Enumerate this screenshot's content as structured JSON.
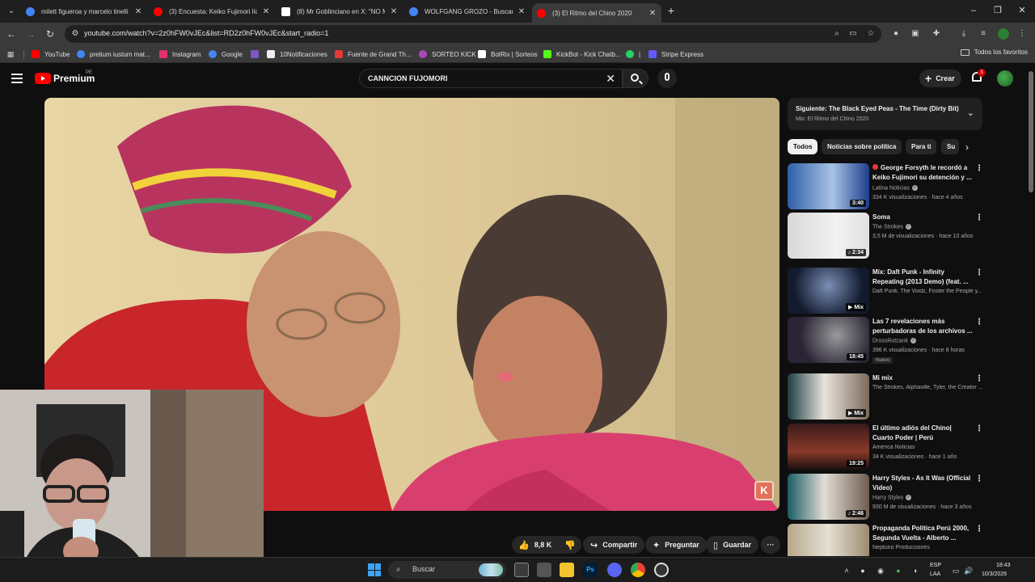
{
  "browser": {
    "tabs": [
      {
        "title": "milett figueroa y marcelo tinelli",
        "favicon_color": "#4285f4",
        "close": "✕"
      },
      {
        "title": "(3) Encuesta: Keiko Fujimori líder",
        "favicon_color": "#ff0000",
        "close": "✕"
      },
      {
        "title": "(8) Mr Goblinciano en X: \"NO M",
        "favicon_color": "#ffffff",
        "close": "✕"
      },
      {
        "title": "WOLFGANG GROZO - Buscar co",
        "favicon_color": "#4285f4",
        "close": "✕"
      },
      {
        "title": "(3) El Ritmo del Chino 2020",
        "favicon_color": "#ff0000",
        "close": "✕",
        "active": true
      }
    ],
    "url": "youtube.com/watch?v=2z0hFW0vJEc&list=RD2z0hFW0vJEc&start_radio=1",
    "bookmarks": [
      {
        "label": "YouTube",
        "color": "#ff0000"
      },
      {
        "label": "pretium iustum mat...",
        "color": "#4285f4"
      },
      {
        "label": "Instagram",
        "color": "#e1306c"
      },
      {
        "label": "Google",
        "color": "#4285f4"
      },
      {
        "label": "",
        "color": "#7e57c2"
      },
      {
        "label": "10Notificaciones",
        "color": "#ffffff"
      },
      {
        "label": "Fuente de Grand Th...",
        "color": "#e53935"
      },
      {
        "label": "SORTEO KICK",
        "color": "#ab47bc"
      },
      {
        "label": "BotRix | Sorteos",
        "color": "#ffffff"
      },
      {
        "label": "KickBot - Kick Chatb...",
        "color": "#53fc18"
      },
      {
        "label": "|",
        "color": "#25d366"
      },
      {
        "label": "Stripe Express",
        "color": "#635bff"
      }
    ],
    "all_bookmarks": "Todos los favoritos"
  },
  "youtube": {
    "logo_text": "Premium",
    "country": "PE",
    "search_query": "CANNCION FUJOMORI",
    "create_label": "Crear",
    "notifications": "3",
    "actions": {
      "likes": "8,8 K",
      "share": "Compartir",
      "ask": "Preguntar",
      "save": "Guardar",
      "more": "···"
    },
    "up_next": {
      "title": "Siguiente: The Black Eyed Peas - The Time (Dirty Bit)",
      "subtitle": "Mix: El Ritmo del Chino 2020"
    },
    "chips": [
      "Todos",
      "Noticias sobre política",
      "Para ti",
      "Su"
    ],
    "recommendations": [
      {
        "title": "George Forsyth le recordó a Keiko Fujimori su detención y ...",
        "channel": "Latina Noticias",
        "meta": "334 K visualizaciones · hace 4 años",
        "duration": "3:40",
        "live": true,
        "verified": true
      },
      {
        "title": "Soma",
        "channel": "The Strokes",
        "meta": "3,5 M de visualizaciones · hace 10 años",
        "duration": "♪ 2:34",
        "verified": true
      },
      {
        "title": "Mix: Daft Punk - Infinity Repeating (2013 Demo) (feat. ...",
        "channel": "Daft Punk, The Voidz, Foster the People y...",
        "meta": "",
        "duration": "▶ Mix"
      },
      {
        "title": "Las 7 revelaciones más perturbadoras de los archivos ...",
        "channel": "DrossRotzank",
        "meta": "396 K visualizaciones · hace 8 horas",
        "duration": "18:45",
        "badge": "Nuevo",
        "verified": true
      },
      {
        "title": "Mi mix",
        "channel": "The Strokes, Alphaville, Tyler, the Creator ...",
        "meta": "",
        "duration": "▶ Mix"
      },
      {
        "title": "El último adiós del Chino| Cuarto Poder | Perú",
        "channel": "América Noticias",
        "meta": "34 K visualizaciones · hace 1 año",
        "duration": "19:25"
      },
      {
        "title": "Harry Styles - As It Was (Official Video)",
        "channel": "Harry Styles",
        "meta": "930 M de visualizaciones · hace 3 años",
        "duration": "♪ 2:46",
        "verified": true
      },
      {
        "title": "Propaganda Política Perú 2000, Segunda Vuelta - Alberto ...",
        "channel": "Neptuno Producciones",
        "meta": "",
        "duration": ""
      }
    ]
  },
  "taskbar": {
    "search": "Buscar",
    "lang1": "ESP",
    "lang2": "LAA",
    "time": "18:43",
    "date": "10/3/2026"
  }
}
